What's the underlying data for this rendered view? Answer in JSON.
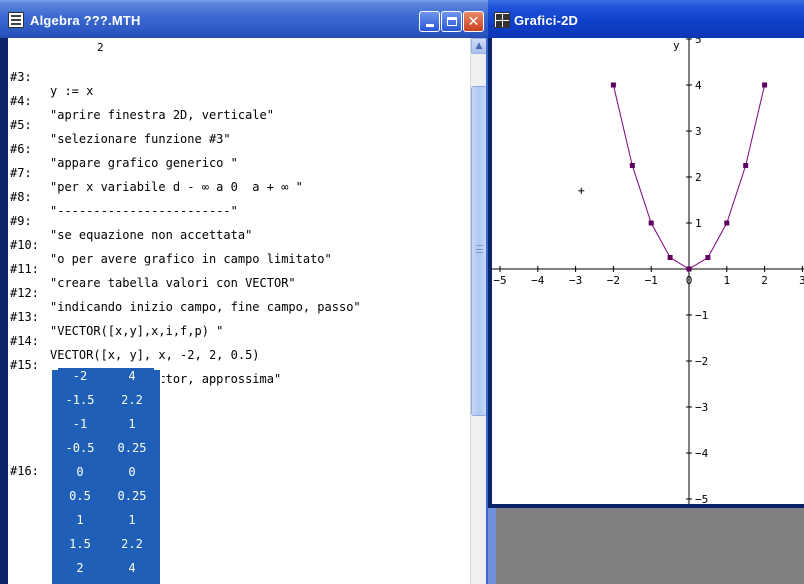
{
  "algebra_window": {
    "title": "Algebra ???.MTH",
    "expressions": [
      {
        "label": "#3:",
        "text": "y := x",
        "superscript": "2"
      },
      {
        "label": "#4:",
        "text": "\"aprire finestra 2D, verticale\""
      },
      {
        "label": "#5:",
        "text": "\"selezionare funzione #3\""
      },
      {
        "label": "#6:",
        "text": "\"appare grafico generico \""
      },
      {
        "label": "#7:",
        "text": "\"per x variabile d - ∞ a 0  a + ∞ \""
      },
      {
        "label": "#8:",
        "text": "\"------------------------\""
      },
      {
        "label": "#9:",
        "text": "\"se equazione non accettata\""
      },
      {
        "label": "#10:",
        "text": "\"o per avere grafico in campo limitato\""
      },
      {
        "label": "#11:",
        "text": "\"creare tabella valori con VECTOR\""
      },
      {
        "label": "#12:",
        "text": "\"indicando inizio campo, fine campo, passo\""
      },
      {
        "label": "#13:",
        "text": "\"VECTOR([x,y],x,i,f,p) \""
      },
      {
        "label": "#14:",
        "text": "VECTOR([x, y], x, -2, 2, 0.5)"
      },
      {
        "label": "#15:",
        "text": "\"selezionare vector, approssima\""
      }
    ],
    "matrix_label": "#16:",
    "matrix": [
      [
        "-2",
        "4"
      ],
      [
        "-1.5",
        "2.2"
      ],
      [
        "-1",
        "1"
      ],
      [
        "-0.5",
        "0.25"
      ],
      [
        "0",
        "0"
      ],
      [
        "0.5",
        "0.25"
      ],
      [
        "1",
        "1"
      ],
      [
        "1.5",
        "2.2"
      ],
      [
        "2",
        "4"
      ]
    ]
  },
  "graph_window": {
    "title": "Grafici-2D"
  },
  "chart_data": {
    "type": "line",
    "title": "",
    "xlabel": "",
    "ylabel": "y",
    "x_ticks": [
      "-5",
      "-4",
      "-3",
      "-2",
      "-1",
      "0",
      "1",
      "2",
      "3"
    ],
    "y_ticks": [
      "5",
      "4",
      "3",
      "2",
      "1",
      "-1",
      "-2",
      "-3",
      "-4",
      "-5"
    ],
    "xlim": [
      -5,
      3
    ],
    "ylim": [
      -5,
      5
    ],
    "grid": false,
    "cursor_marker": {
      "x": -2.85,
      "y": 1.7
    },
    "series": [
      {
        "x": [
          -2,
          -1.5,
          -1,
          -0.5,
          0,
          0.5,
          1,
          1.5,
          2
        ],
        "y": [
          4,
          2.25,
          1,
          0.25,
          0,
          0.25,
          1,
          2.25,
          4
        ],
        "color": "#800080",
        "marker_color": "#600060"
      }
    ]
  }
}
